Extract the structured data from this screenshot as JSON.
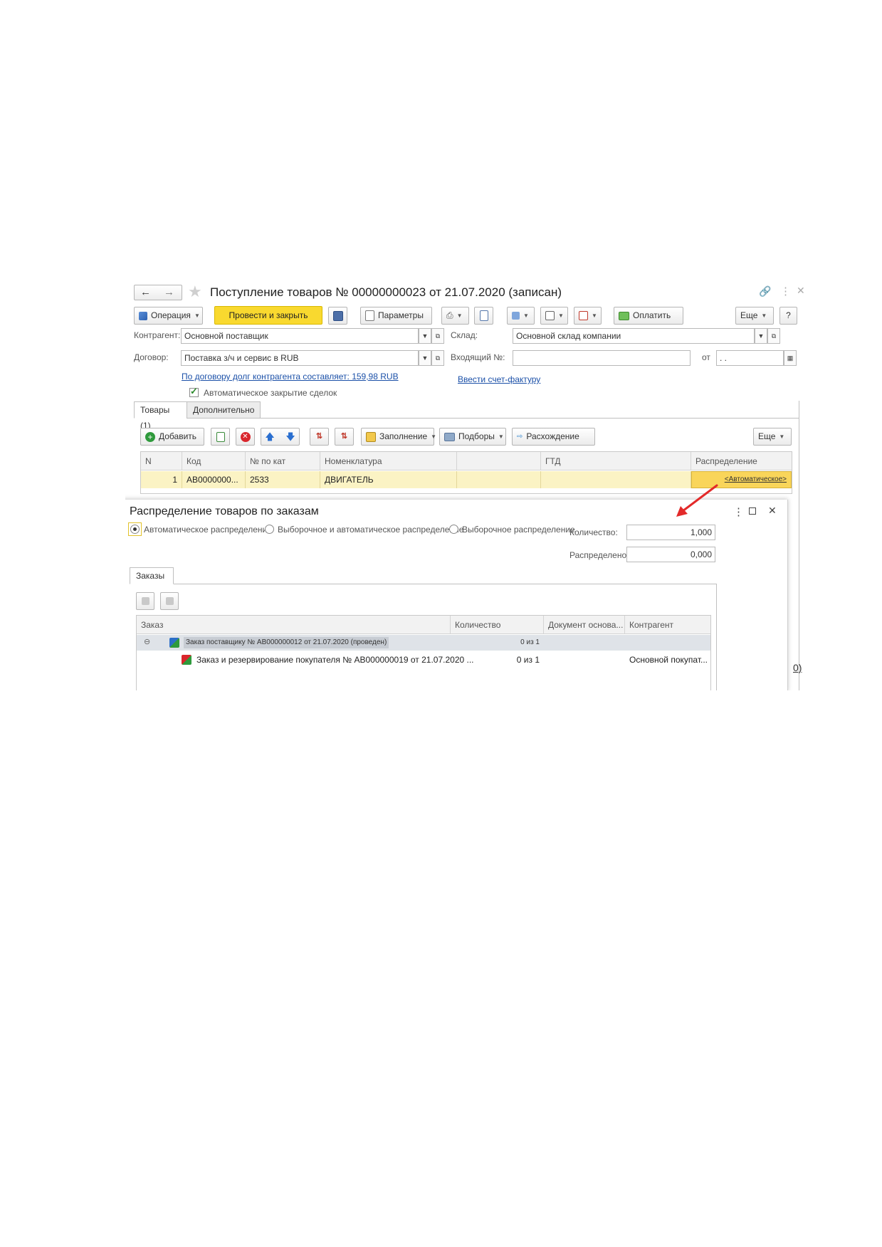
{
  "window": {
    "title": "Поступление товаров № 00000000023 от 21.07.2020 (записан)"
  },
  "toolbar": {
    "operation": "Операция",
    "post_close": "Провести и закрыть",
    "parameters": "Параметры",
    "pay": "Оплатить",
    "more": "Еще",
    "help": "?"
  },
  "form": {
    "contractor_label": "Контрагент:",
    "contractor_value": "Основной поставщик",
    "warehouse_label": "Склад:",
    "warehouse_value": "Основной склад компании",
    "contract_label": "Договор:",
    "contract_value": "Поставка з/ч и сервис в RUB",
    "incoming_label": "Входящий №:",
    "incoming_value": "",
    "from_label": "от",
    "date_value": ". .",
    "debt_link": "По договору долг контрагента составляет: 159,98 RUB",
    "invoice_link": "Ввести счет-фактуру",
    "auto_close_label": "Автоматическое закрытие сделок",
    "auto_close_checked": true
  },
  "tabs": [
    {
      "label": "Товары (1)",
      "active": true
    },
    {
      "label": "Дополнительно",
      "active": false
    }
  ],
  "goods_toolbar": {
    "add": "Добавить",
    "fill": "Заполнение",
    "selections": "Подборы",
    "discrepancy": "Расхождение",
    "more": "Еще"
  },
  "goods_table": {
    "columns": [
      "N",
      "Код",
      "№ по кат",
      "Номенклатура",
      "",
      "ГТД",
      "Распределение"
    ],
    "rows": [
      {
        "n": "1",
        "code": "АВ0000000...",
        "cat": "2533",
        "name": "ДВИГАТЕЛЬ",
        "extra": "",
        "gtd": "",
        "dist": "<Автоматическое>"
      }
    ]
  },
  "dialog": {
    "title": "Распределение товаров по заказам",
    "modes": [
      {
        "label": "Автоматическое распределение",
        "selected": true
      },
      {
        "label": "Выборочное и автоматическое распределение",
        "selected": false
      },
      {
        "label": "Выборочное распределение",
        "selected": false
      }
    ],
    "qty_label": "Количество:",
    "qty_value": "1,000",
    "distributed_label": "Распределено:",
    "distributed_value": "0,000",
    "tab": "Заказы",
    "columns": [
      "Заказ",
      "Количество",
      "Документ основа...",
      "Контрагент"
    ],
    "rows": [
      {
        "order": "Заказ поставщику № АВ000000012 от 21.07.2020 (проведен)",
        "qty": "0 из 1",
        "doc": "",
        "contractor": ""
      },
      {
        "order": "Заказ и резервирование покупателя № АВ000000019 от 21.07.2020 ...",
        "qty": "0 из 1",
        "doc": "",
        "contractor": "Основной покупат..."
      }
    ]
  },
  "edge_fragment": "0)",
  "colors": {
    "accent_yellow": "#f9d92f",
    "row_highlight": "#fbf3c4",
    "link_blue": "#1b50a8",
    "arrow_red": "#e32a2a"
  }
}
